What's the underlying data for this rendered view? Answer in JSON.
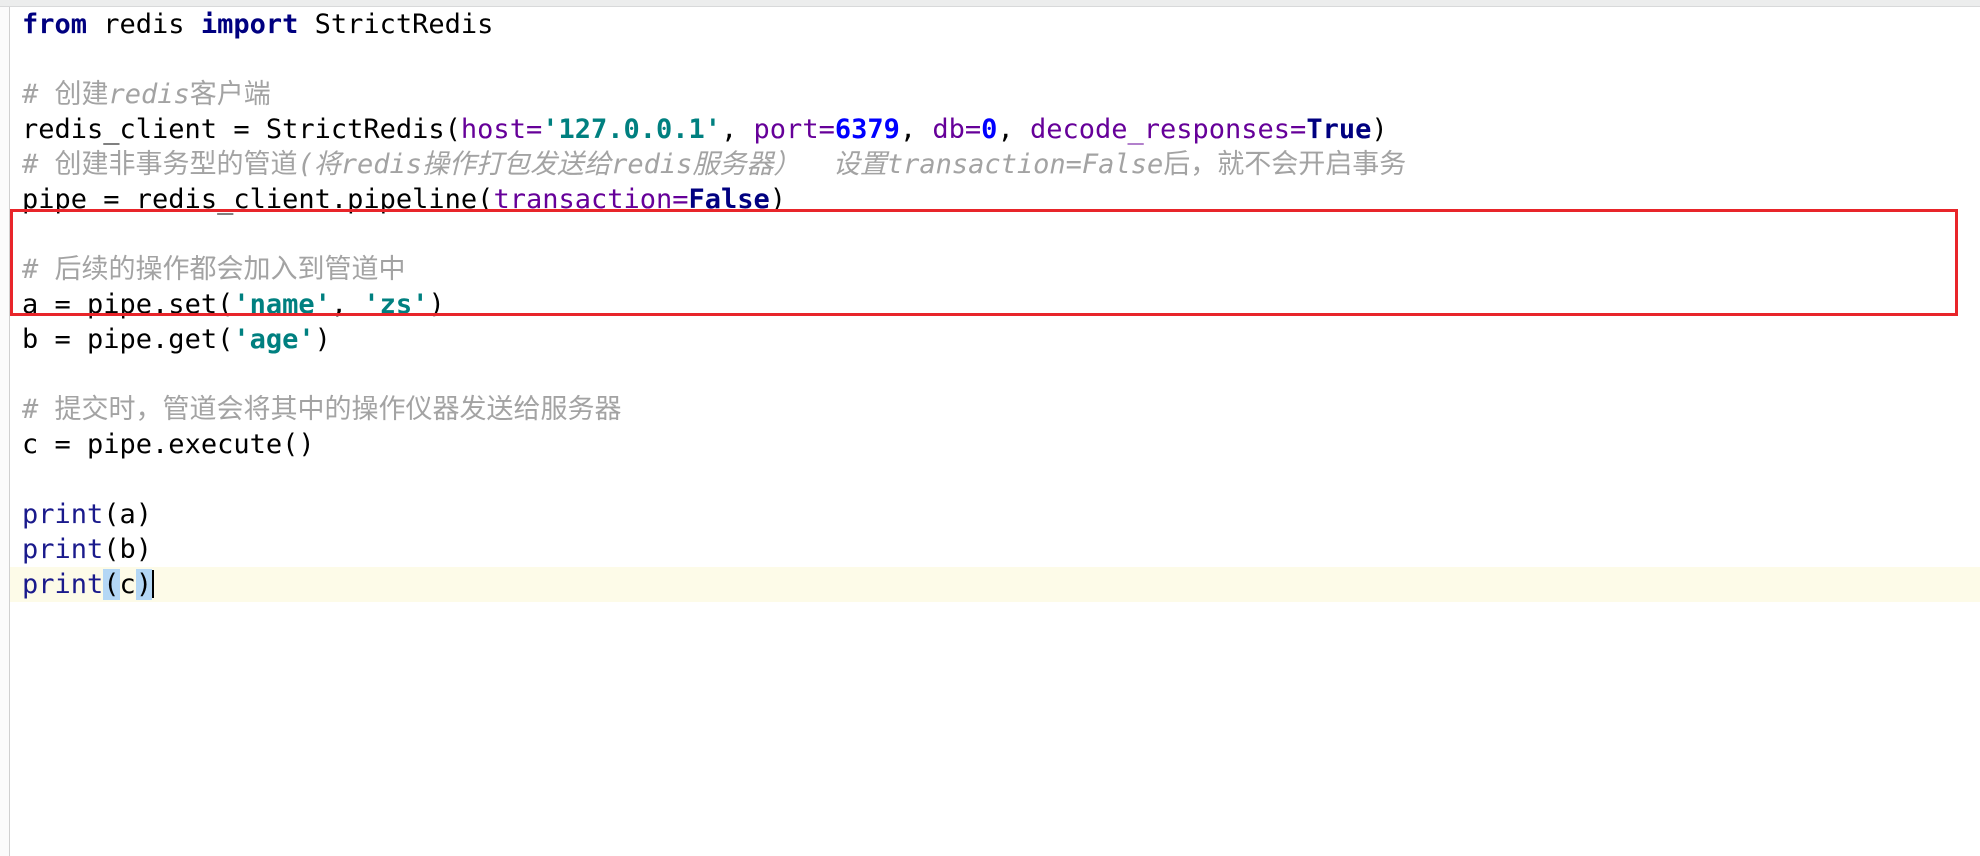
{
  "editor": {
    "language": "python",
    "file_type": "Python source",
    "gutter_visible": true,
    "caret_line_index": 13,
    "caret_column": 8
  },
  "colors": {
    "background": "#ffffff",
    "keyword": "#000080",
    "comment": "#a3a3a3",
    "string": "#008080",
    "number": "#0000ff",
    "keyword_argument": "#660099",
    "builtin_function": "#1a1a8c",
    "annotation_box": "#e8252a",
    "current_line_highlight": "#fdfbe8",
    "bracket_match_highlight": "#b4d7f5",
    "gutter": "#fbfbfb",
    "top_strip": "#eceded"
  },
  "annotation": {
    "type": "red-rectangle",
    "covers_lines": [
      4,
      5
    ],
    "color": "#e8252a"
  },
  "code": {
    "lines": [
      {
        "index": 0,
        "plain": "from redis import StrictRedis",
        "tokens": [
          {
            "t": "from",
            "c": "kw"
          },
          {
            "t": " redis ",
            "c": "ident"
          },
          {
            "t": "import",
            "c": "kw"
          },
          {
            "t": " StrictRedis",
            "c": "ident"
          }
        ]
      },
      {
        "index": 1,
        "plain": "",
        "tokens": []
      },
      {
        "index": 2,
        "plain": "# 创建redis客户端",
        "tokens": [
          {
            "t": "# ",
            "c": "cmt"
          },
          {
            "t": "创建",
            "c": "cmt-cjk"
          },
          {
            "t": "redis",
            "c": "cmt-em"
          },
          {
            "t": "客户端",
            "c": "cmt-cjk"
          }
        ]
      },
      {
        "index": 3,
        "plain": "redis_client = StrictRedis(host='127.0.0.1', port=6379, db=0, decode_responses=True)",
        "tokens": [
          {
            "t": "redis_client ",
            "c": "ident"
          },
          {
            "t": "= ",
            "c": "op"
          },
          {
            "t": "StrictRedis",
            "c": "ident"
          },
          {
            "t": "(",
            "c": "op"
          },
          {
            "t": "host",
            "c": "kwarg"
          },
          {
            "t": "=",
            "c": "kwarg"
          },
          {
            "t": "'127.0.0.1'",
            "c": "str"
          },
          {
            "t": ", ",
            "c": "op"
          },
          {
            "t": "port",
            "c": "kwarg"
          },
          {
            "t": "=",
            "c": "kwarg"
          },
          {
            "t": "6379",
            "c": "num"
          },
          {
            "t": ", ",
            "c": "op"
          },
          {
            "t": "db",
            "c": "kwarg"
          },
          {
            "t": "=",
            "c": "kwarg"
          },
          {
            "t": "0",
            "c": "num"
          },
          {
            "t": ", ",
            "c": "op"
          },
          {
            "t": "decode_responses",
            "c": "kwarg"
          },
          {
            "t": "=",
            "c": "kwarg"
          },
          {
            "t": "True",
            "c": "bconst"
          },
          {
            "t": ")",
            "c": "op"
          }
        ]
      },
      {
        "index": 4,
        "plain": "# 创建非事务型的管道(将redis操作打包发送给redis服务器)  设置transaction=False后，就不会开启事务",
        "tokens": [
          {
            "t": "# ",
            "c": "cmt"
          },
          {
            "t": "创建非事务型的管道",
            "c": "cmt-cjk"
          },
          {
            "t": "(",
            "c": "cmt-em"
          },
          {
            "t": "将",
            "c": "cmt-cjk-em"
          },
          {
            "t": "redis",
            "c": "cmt-em"
          },
          {
            "t": "操作打包发送给",
            "c": "cmt-cjk-em"
          },
          {
            "t": "redis",
            "c": "cmt-em"
          },
          {
            "t": "服务器）",
            "c": "cmt-cjk-em"
          },
          {
            "t": "  ",
            "c": "cmt"
          },
          {
            "t": "设置",
            "c": "cmt-cjk-em"
          },
          {
            "t": "transaction=False",
            "c": "cmt-em"
          },
          {
            "t": "后，就不会开启事务",
            "c": "cmt-cjk"
          }
        ]
      },
      {
        "index": 5,
        "plain": "pipe = redis_client.pipeline(transaction=False)",
        "tokens": [
          {
            "t": "pipe ",
            "c": "ident"
          },
          {
            "t": "= ",
            "c": "op"
          },
          {
            "t": "redis_client.pipeline",
            "c": "ident"
          },
          {
            "t": "(",
            "c": "op"
          },
          {
            "t": "transaction",
            "c": "kwarg"
          },
          {
            "t": "=",
            "c": "kwarg"
          },
          {
            "t": "False",
            "c": "bconst"
          },
          {
            "t": ")",
            "c": "op"
          }
        ]
      },
      {
        "index": 6,
        "plain": "",
        "tokens": []
      },
      {
        "index": 7,
        "plain": "# 后续的操作都会加入到管道中",
        "tokens": [
          {
            "t": "# ",
            "c": "cmt"
          },
          {
            "t": "后续的操作都会加入到管道中",
            "c": "cmt-cjk"
          }
        ]
      },
      {
        "index": 8,
        "plain": "a = pipe.set('name', 'zs')",
        "tokens": [
          {
            "t": "a ",
            "c": "ident"
          },
          {
            "t": "= ",
            "c": "op"
          },
          {
            "t": "pipe.set",
            "c": "ident"
          },
          {
            "t": "(",
            "c": "op"
          },
          {
            "t": "'name'",
            "c": "str"
          },
          {
            "t": ", ",
            "c": "op"
          },
          {
            "t": "'zs'",
            "c": "str"
          },
          {
            "t": ")",
            "c": "op"
          }
        ]
      },
      {
        "index": 9,
        "plain": "b = pipe.get('age')",
        "tokens": [
          {
            "t": "b ",
            "c": "ident"
          },
          {
            "t": "= ",
            "c": "op"
          },
          {
            "t": "pipe.get",
            "c": "ident"
          },
          {
            "t": "(",
            "c": "op"
          },
          {
            "t": "'age'",
            "c": "str"
          },
          {
            "t": ")",
            "c": "op"
          }
        ]
      },
      {
        "index": 10,
        "plain": "",
        "tokens": []
      },
      {
        "index": 11,
        "plain": "# 提交时，管道会将其中的操作仪器发送给服务器",
        "tokens": [
          {
            "t": "# ",
            "c": "cmt"
          },
          {
            "t": "提交时，管道会将其中的操作仪器发送给服务器",
            "c": "cmt-cjk"
          }
        ]
      },
      {
        "index": 12,
        "plain": "c = pipe.execute()",
        "tokens": [
          {
            "t": "c ",
            "c": "ident"
          },
          {
            "t": "= ",
            "c": "op"
          },
          {
            "t": "pipe.execute",
            "c": "ident"
          },
          {
            "t": "()",
            "c": "op"
          }
        ]
      },
      {
        "index": 13,
        "plain": "",
        "tokens": []
      },
      {
        "index": 14,
        "plain": "print(a)",
        "tokens": [
          {
            "t": "print",
            "c": "builtin"
          },
          {
            "t": "(a)",
            "c": "op"
          }
        ]
      },
      {
        "index": 15,
        "plain": "print(b)",
        "tokens": [
          {
            "t": "print",
            "c": "builtin"
          },
          {
            "t": "(b)",
            "c": "op"
          }
        ]
      },
      {
        "index": 16,
        "plain": "print(c)",
        "current": true,
        "tokens": [
          {
            "t": "print",
            "c": "builtin"
          },
          {
            "t": "(",
            "c": "op-match"
          },
          {
            "t": "c",
            "c": "op"
          },
          {
            "t": ")",
            "c": "op-match"
          }
        ]
      }
    ]
  }
}
